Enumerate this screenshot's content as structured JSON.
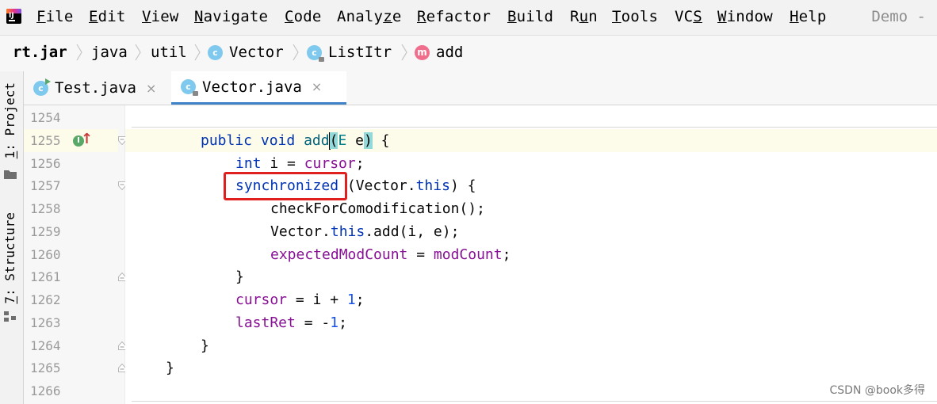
{
  "menu": {
    "items": [
      {
        "pre": "",
        "u": "F",
        "post": "ile"
      },
      {
        "pre": "",
        "u": "E",
        "post": "dit"
      },
      {
        "pre": "",
        "u": "V",
        "post": "iew"
      },
      {
        "pre": "",
        "u": "N",
        "post": "avigate"
      },
      {
        "pre": "",
        "u": "C",
        "post": "ode"
      },
      {
        "pre": "Analy",
        "u": "z",
        "post": "e"
      },
      {
        "pre": "",
        "u": "R",
        "post": "efactor"
      },
      {
        "pre": "",
        "u": "B",
        "post": "uild"
      },
      {
        "pre": "R",
        "u": "u",
        "post": "n"
      },
      {
        "pre": "",
        "u": "T",
        "post": "ools"
      },
      {
        "pre": "VC",
        "u": "S",
        "post": ""
      },
      {
        "pre": "",
        "u": "W",
        "post": "indow"
      },
      {
        "pre": "",
        "u": "H",
        "post": "elp"
      }
    ],
    "project": "Demo -"
  },
  "breadcrumb": {
    "jar": "rt.jar",
    "pkg1": "java",
    "pkg2": "util",
    "cls": "Vector",
    "inner": "ListItr",
    "method": "add",
    "class_icon_letter": "c",
    "method_icon_letter": "m"
  },
  "tool_windows": {
    "project_num": "1",
    "project_label": ": Project",
    "structure_num": "7",
    "structure_label": ": Structure"
  },
  "tabs": [
    {
      "label": "Test.java",
      "icon_letter": "c",
      "close": "×",
      "active": false
    },
    {
      "label": "Vector.java",
      "icon_letter": "c",
      "close": "×",
      "active": true
    }
  ],
  "editor": {
    "line_numbers": [
      "1254",
      "1255",
      "1256",
      "1257",
      "1258",
      "1259",
      "1260",
      "1261",
      "1262",
      "1263",
      "1264",
      "1265",
      "1266"
    ],
    "impl_marker": "I",
    "override_marker": "↑",
    "code": {
      "l1255": {
        "kw1": "public",
        "kw2": "void",
        "fn": "add",
        "p1": "(",
        "tp": "E",
        "p2": " e",
        "p3": ")",
        "end": " {"
      },
      "l1256": {
        "kw": "int",
        "mid": " i = ",
        "fld": "cursor",
        "end": ";"
      },
      "l1257": {
        "kw": "synchronized",
        "p1": " (Vector.",
        "kw2": "this",
        "end": ") {"
      },
      "l1258": {
        "text": "checkForComodification();"
      },
      "l1259": {
        "p1": "Vector.",
        "kw": "this",
        "end": ".add(i, e);"
      },
      "l1260": {
        "fld1": "expectedModCount",
        "mid": " = ",
        "fld2": "modCount",
        "end": ";"
      },
      "l1261": {
        "text": "}"
      },
      "l1262": {
        "fld": "cursor",
        "mid": " = i + ",
        "num": "1",
        "end": ";"
      },
      "l1263": {
        "fld": "lastRet",
        "mid": " = -",
        "num": "1",
        "end": ";"
      },
      "l1264": {
        "text": "}"
      },
      "l1265": {
        "text": "}"
      }
    }
  },
  "watermark": "CSDN @book多得",
  "colors": {
    "keyword": "#0033b3",
    "method": "#00627a",
    "field": "#871094",
    "number": "#1750eb",
    "type_param": "#007e8a",
    "highlight_box": "#e0201e",
    "active_tab_underline": "#4083c9"
  }
}
